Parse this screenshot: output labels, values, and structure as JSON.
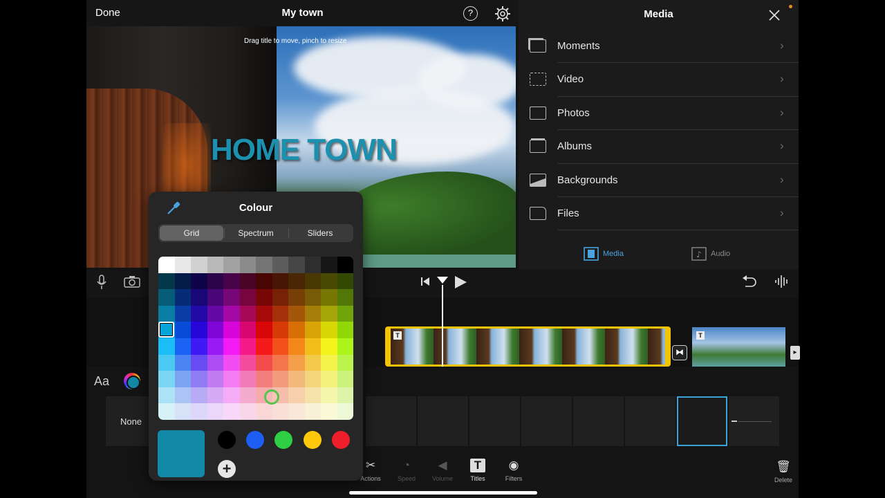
{
  "topbar": {
    "done": "Done",
    "title": "My town",
    "help": "?"
  },
  "preview": {
    "hint": "Drag title to move, pinch to resize",
    "title_text": "HOME TOWN"
  },
  "media": {
    "header": "Media",
    "items": [
      {
        "label": "Moments",
        "icon": "moments-icon"
      },
      {
        "label": "Video",
        "icon": "film-icon"
      },
      {
        "label": "Photos",
        "icon": "photo-frame-icon"
      },
      {
        "label": "Albums",
        "icon": "album-stack-icon"
      },
      {
        "label": "Backgrounds",
        "icon": "landscape-icon"
      },
      {
        "label": "Files",
        "icon": "folder-icon"
      }
    ],
    "tabs": [
      {
        "label": "Media",
        "active": true
      },
      {
        "label": "Audio",
        "active": false
      }
    ],
    "accent": "#4aa3df"
  },
  "title_styles": {
    "aa": "Aa",
    "none": "None"
  },
  "colour_popover": {
    "title": "Colour",
    "tabs": [
      "Grid",
      "Spectrum",
      "Sliders"
    ],
    "active_tab": "Grid",
    "selected_colour": "#1389a8",
    "recent_colours": [
      "#000000",
      "#1f5ef5",
      "#2fcf45",
      "#ffc80a",
      "#ee1f2b"
    ],
    "add": "+"
  },
  "toolbar": {
    "actions": "Actions",
    "speed": "Speed",
    "volume": "Volume",
    "titles": "Titles",
    "filters": "Filters",
    "delete": "Delete"
  }
}
